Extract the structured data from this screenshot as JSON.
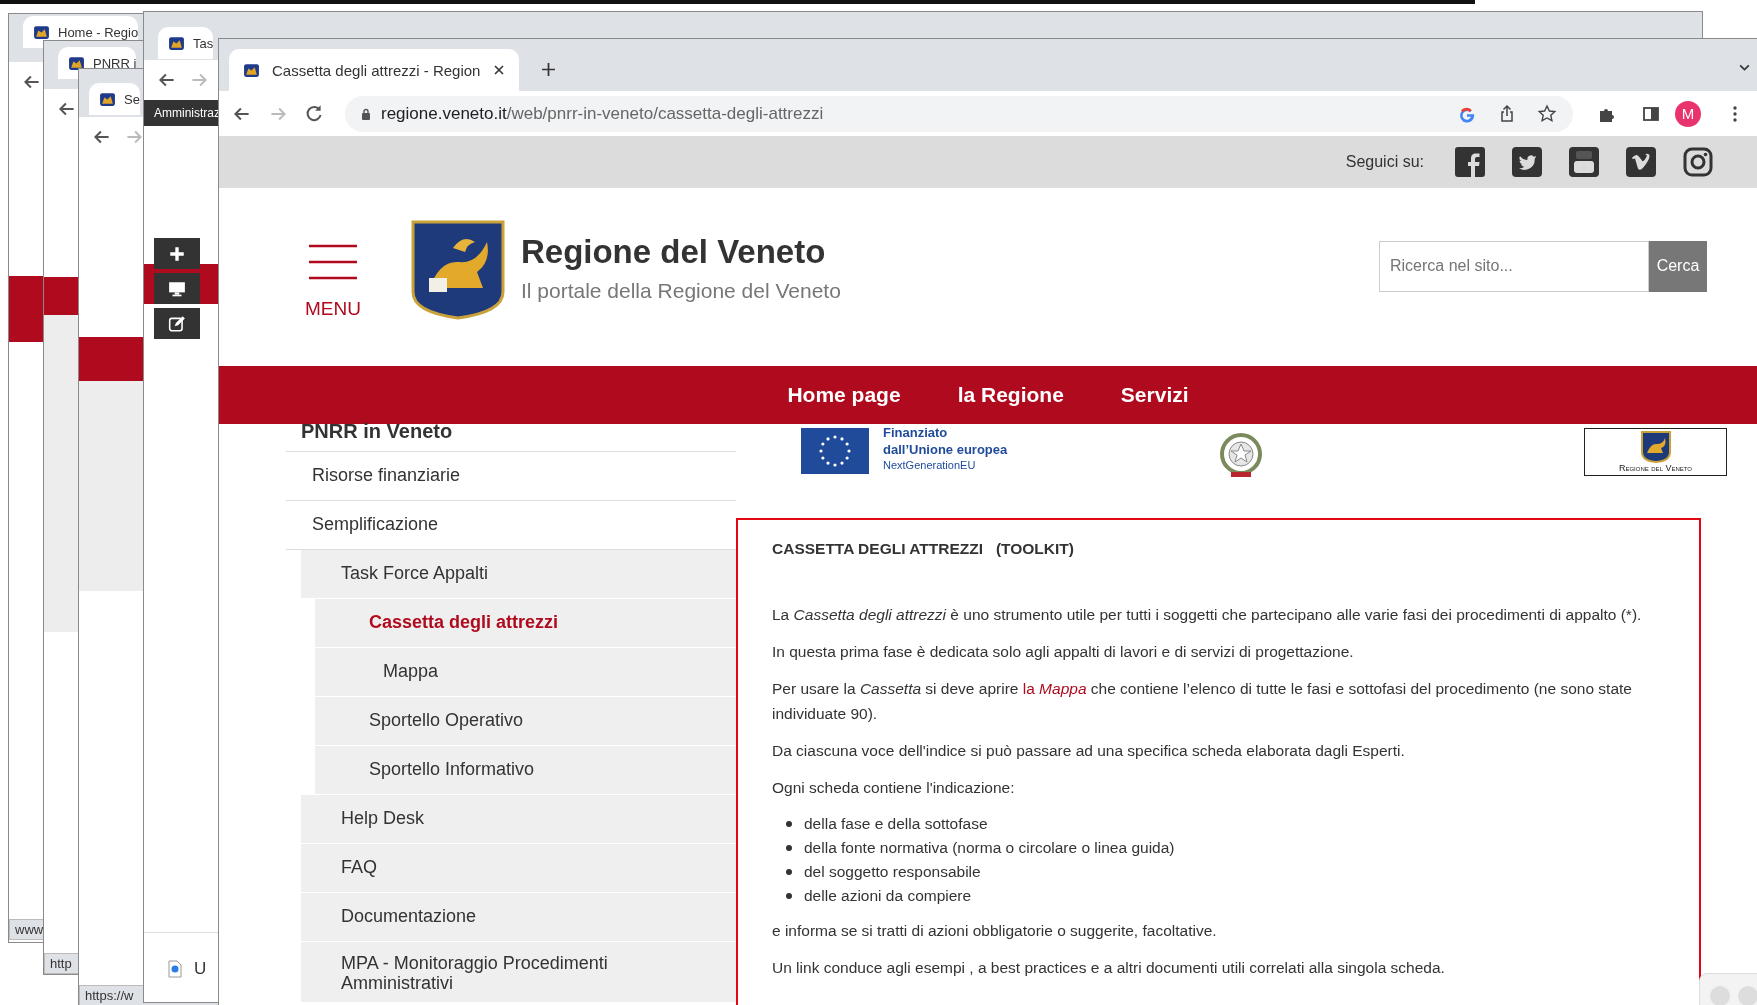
{
  "background_windows": [
    {
      "tab_title": "Home - Regio",
      "status_url": "www"
    },
    {
      "tab_title": "PNRR i",
      "status_url": "http"
    },
    {
      "tab_title": "Se",
      "status_url": "https://w"
    },
    {
      "tab_title": "Tas",
      "banner": "Amministraz",
      "status_item": "U"
    }
  ],
  "window": {
    "tab_title": "Cassetta degli attrezzi - Region",
    "url_host": "regione.veneto.it",
    "url_path": "/web/pnrr-in-veneto/cassetta-degli-attrezzi",
    "avatar": "M"
  },
  "social_bar": {
    "label": "Seguici su:"
  },
  "header": {
    "menu_label": "MENU",
    "title": "Regione del Veneto",
    "subtitle": "Il portale della Regione del Veneto",
    "search": {
      "placeholder": "Ricerca nel sito..."
    },
    "search_button": "Cerca"
  },
  "nav": [
    "Home page",
    "la Regione",
    "Servizi"
  ],
  "sidebar": {
    "title": "PNRR in Veneto",
    "items": [
      {
        "label": "Risorse finanziarie",
        "selected": false
      },
      {
        "label": "Semplificazione",
        "selected": false,
        "children": [
          {
            "label": "Task Force Appalti",
            "selected": false,
            "children": [
              {
                "label": "Cassetta degli attrezzi",
                "selected": true,
                "children": [
                  {
                    "label": "Mappa",
                    "selected": false
                  }
                ]
              },
              {
                "label": "Sportello Operativo",
                "selected": false
              },
              {
                "label": "Sportello Informativo",
                "selected": false
              }
            ]
          },
          {
            "label": "Help Desk",
            "selected": false
          },
          {
            "label": "FAQ",
            "selected": false
          },
          {
            "label": "Documentazione",
            "selected": false
          },
          {
            "label": "MPA - Monitoraggio Procedimenti Amministrativi",
            "selected": false
          }
        ]
      }
    ]
  },
  "logos": {
    "eu_line1": "Finanziato",
    "eu_line2": "dall’Unione europea",
    "eu_line3": "NextGenerationEU",
    "veneto_caption": "Regione del Veneto"
  },
  "article": {
    "title": "CASSETTA DEGLI ATTREZZI   (TOOLKIT)",
    "blocks": [
      {
        "kind": "paragraph",
        "text": "La *Cassetta degli attrezzi* è uno strumento utile per tutti i soggetti che partecipano alle varie fasi dei procedimenti di appalto (*)."
      },
      {
        "kind": "paragraph",
        "text": "In questa prima fase è dedicata solo agli appalti di lavori e di servizi di progettazione."
      },
      {
        "kind": "link_paragraph",
        "before": "Per usare la *Cassetta* si deve aprire ",
        "link": "la *Mappa*",
        "after": " che contiene l’elenco di tutte le fasi e sottofasi del procedimento (ne sono state individuate 90)."
      },
      {
        "kind": "paragraph",
        "text": "Da ciascuna voce dell'indice si può passare ad una specifica scheda elaborata dagli Esperti."
      },
      {
        "kind": "paragraph",
        "text": "Ogni scheda contiene l'indicazione:"
      },
      {
        "kind": "list",
        "items": [
          "della fase e della sottofase",
          "della fonte normativa (norma o circolare o linea guida)",
          "del soggetto responsabile",
          "delle azioni da compiere"
        ]
      },
      {
        "kind": "paragraph",
        "text": "e informa se si tratti di azioni obbligatorie o suggerite, facoltative."
      },
      {
        "kind": "paragraph",
        "text": "Un link conduce agli esempi , a best practices e a altri documenti utili correlati alla singola scheda."
      }
    ]
  }
}
